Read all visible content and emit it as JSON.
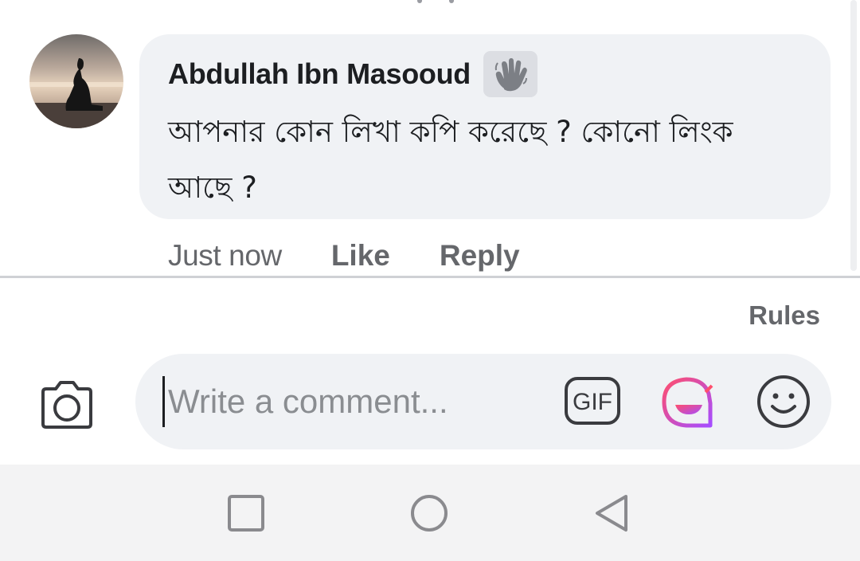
{
  "comment": {
    "author": "Abdullah Ibn Masooud",
    "author_badge_icon": "wave-hand-icon",
    "text": "আপনার কোন লিখা কপি করেছে ? কোনো লিংক আছে ?",
    "timestamp": "Just now",
    "like_label": "Like",
    "reply_label": "Reply"
  },
  "composer": {
    "rules_label": "Rules",
    "placeholder": "Write a comment...",
    "camera_icon": "camera-icon",
    "gif_label": "GIF",
    "sticker_icon": "sticker-icon",
    "emoji_icon": "emoji-icon"
  },
  "navbar": {
    "items": [
      "recent-apps-icon",
      "home-icon",
      "back-icon"
    ]
  },
  "colors": {
    "bubble_bg": "#f0f2f5",
    "secondary_text": "#65676b",
    "primary_text": "#1c1e21",
    "sticker_gradient_start": "#ff4f6d",
    "sticker_gradient_end": "#a64dff"
  }
}
